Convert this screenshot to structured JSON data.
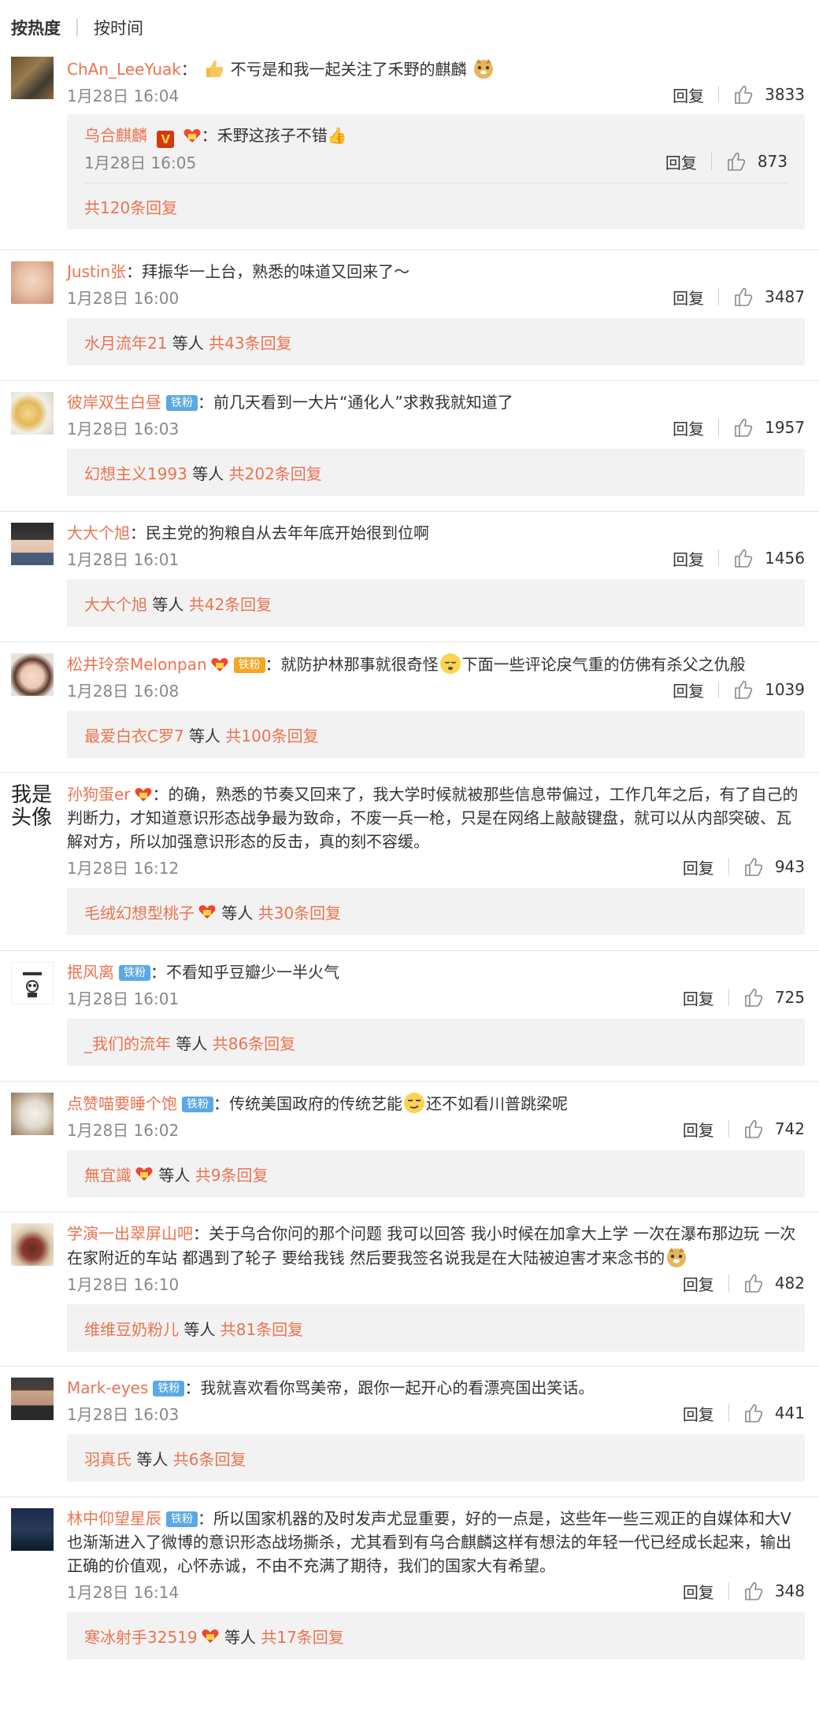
{
  "tabs": {
    "hot": "按热度",
    "time": "按时间"
  },
  "reply_label": "回复",
  "comments": [
    {
      "user": "ChAn_LeeYuak",
      "sep": "：",
      "text": "不亏是和我一起关注了禾野的麒麟",
      "time": "1月28日 16:04",
      "likes": "3833",
      "sub": {
        "user": "乌合麒麟",
        "sep": "：",
        "text": "禾野这孩子不错👍",
        "time": "1月28日 16:05",
        "likes": "873"
      },
      "more": "共120条回复"
    },
    {
      "user": "Justin张",
      "sep": "：",
      "text": "拜振华一上台，熟悉的味道又回来了～",
      "time": "1月28日 16:00",
      "likes": "3487",
      "reply_user": "水月流年21",
      "reply_mid": " 等人 ",
      "reply_count": "共43条回复"
    },
    {
      "user": "彼岸双生白昼",
      "fan": "铁粉",
      "sep": "：",
      "text": "前几天看到一大片“通化人”求救我就知道了",
      "time": "1月28日 16:03",
      "likes": "1957",
      "reply_user": "幻想主义1993",
      "reply_mid": " 等人 ",
      "reply_count": "共202条回复"
    },
    {
      "user": "大大个旭",
      "sep": "：",
      "text": "民主党的狗粮自从去年年底开始很到位啊",
      "time": "1月28日 16:01",
      "likes": "1456",
      "reply_user": "大大个旭",
      "reply_mid": " 等人 ",
      "reply_count": "共42条回复"
    },
    {
      "user": "松井玲奈Melonpan",
      "fan": "铁粉",
      "sep": "：",
      "text": "就防护林那事就很奇怪",
      "text2": "下面一些评论戾气重的仿佛有杀父之仇般",
      "time": "1月28日 16:08",
      "likes": "1039",
      "reply_user": "最爱白衣C罗7",
      "reply_mid": " 等人 ",
      "reply_count": "共100条回复"
    },
    {
      "user": "孙狗蛋er",
      "avatar_text": "我是头像",
      "sep": "：",
      "text": "的确，熟悉的节奏又回来了，我大学时候就被那些信息带偏过，工作几年之后，有了自己的判断力，才知道意识形态战争最为致命，不废一兵一枪，只是在网络上敲敲键盘，就可以从内部突破、瓦解对方，所以加强意识形态的反击，真的刻不容缓。",
      "time": "1月28日 16:12",
      "likes": "943",
      "reply_user": "毛绒幻想型桃子",
      "reply_mid": " 等人 ",
      "reply_count": "共30条回复"
    },
    {
      "user": "抿风离",
      "fan": "铁粉",
      "sep": "：",
      "text": "不看知乎豆瓣少一半火气",
      "time": "1月28日 16:01",
      "likes": "725",
      "reply_user": "_我们的流年",
      "reply_mid": " 等人 ",
      "reply_count": "共86条回复"
    },
    {
      "user": "点赞喵要睡个饱",
      "fan": "铁粉",
      "sep": "：",
      "text": "传统美国政府的传统艺能",
      "text2": "还不如看川普跳梁呢",
      "time": "1月28日 16:02",
      "likes": "742",
      "reply_user": "無宜識",
      "reply_mid": " 等人 ",
      "reply_count": "共9条回复"
    },
    {
      "user": "学演一出翠屏山吧",
      "sep": "：",
      "text": "关于乌合你问的那个问题 我可以回答 我小时候在加拿大上学 一次在瀑布那边玩 一次在家附近的车站 都遇到了轮子 要给我钱 然后要我签名说我是在大陆被迫害才来念书的",
      "time": "1月28日 16:10",
      "likes": "482",
      "reply_user": "维维豆奶粉儿",
      "reply_mid": " 等人 ",
      "reply_count": "共81条回复"
    },
    {
      "user": "Mark-eyes",
      "fan": "铁粉",
      "sep": "：",
      "text": "我就喜欢看你骂美帝，跟你一起开心的看漂亮国出笑话。",
      "time": "1月28日 16:03",
      "likes": "441",
      "reply_user": "羽真氏",
      "reply_mid": " 等人 ",
      "reply_count": "共6条回复"
    },
    {
      "user": "林中仰望星辰",
      "fan": "铁粉",
      "sep": "：",
      "text": "所以国家机器的及时发声尤显重要，好的一点是，这些年一些三观正的自媒体和大V也渐渐进入了微博的意识形态战场撕杀，尤其看到有乌合麒麟这样有想法的年轻一代已经成长起来，输出正确的价值观，心怀赤诚，不由不充满了期待，我们的国家大有希望。",
      "time": "1月28日 16:14",
      "likes": "348",
      "reply_user": "寒冰射手32519",
      "reply_mid": " 等人 ",
      "reply_count": "共17条回复"
    }
  ]
}
